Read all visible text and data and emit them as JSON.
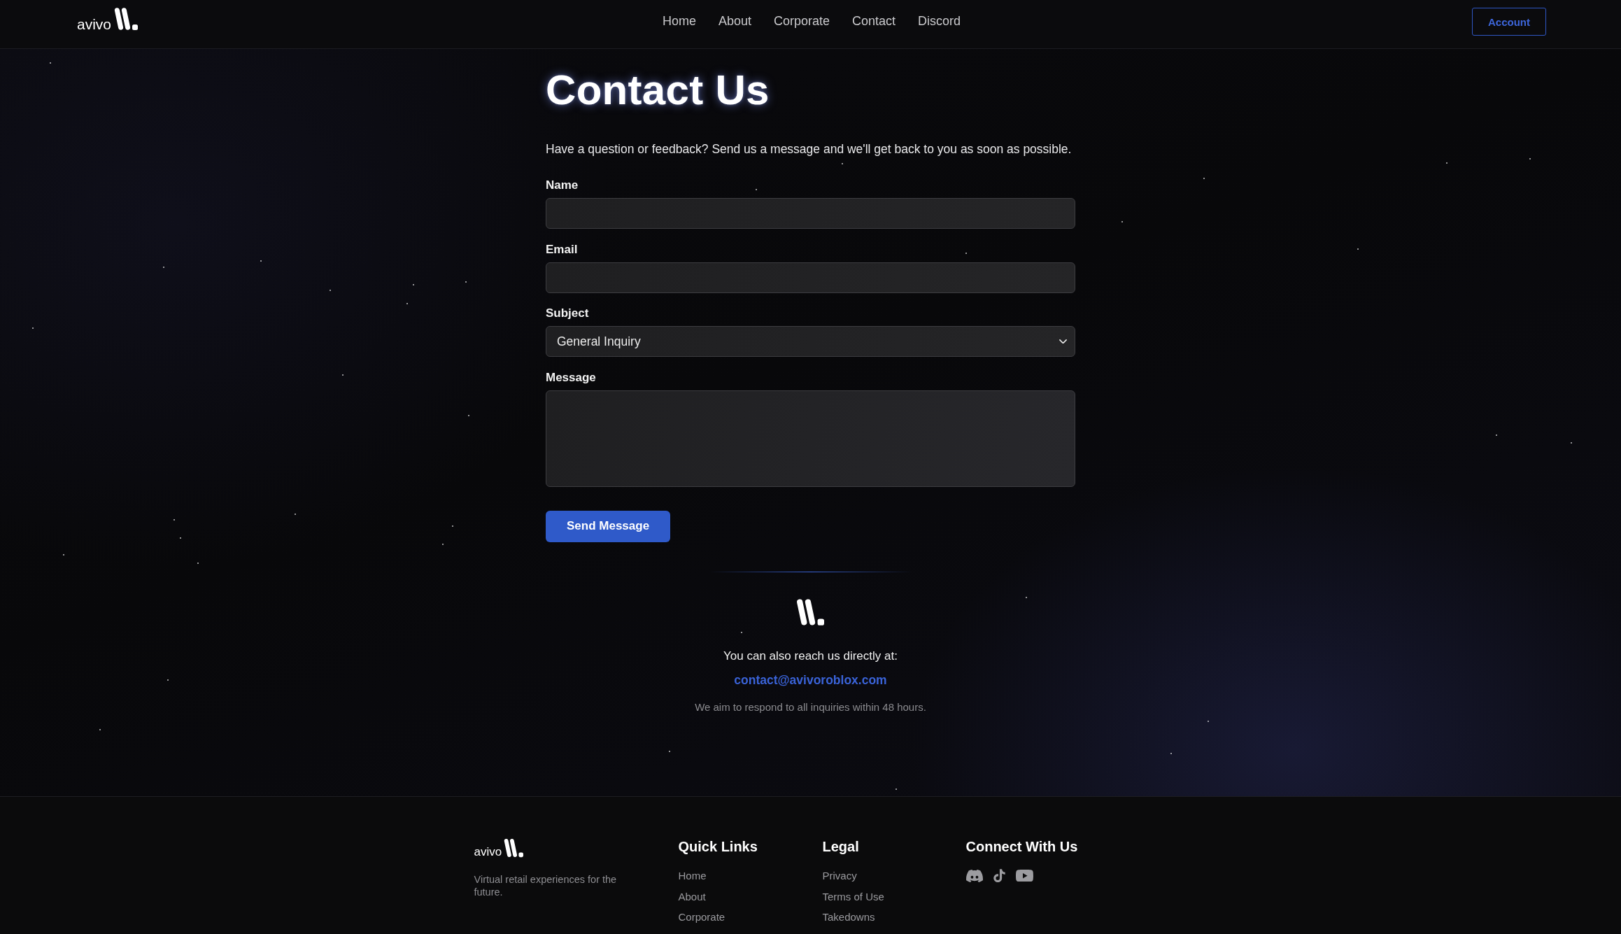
{
  "header": {
    "logo": {
      "wordmark": "avivo"
    },
    "nav": [
      {
        "label": "Home"
      },
      {
        "label": "About"
      },
      {
        "label": "Corporate"
      },
      {
        "label": "Contact"
      },
      {
        "label": "Discord"
      }
    ],
    "account_button": "Account"
  },
  "contact": {
    "title": "Contact Us",
    "intro": "Have a question or feedback? Send us a message and we'll get back to you as soon as possible.",
    "form": {
      "fields": [
        {
          "kind": "input",
          "label": "Name"
        },
        {
          "kind": "input",
          "label": "Email"
        },
        {
          "kind": "select",
          "label": "Subject",
          "value": "General Inquiry"
        },
        {
          "kind": "textarea",
          "label": "Message"
        }
      ],
      "submit_button": "Send Message"
    }
  },
  "direct_contact": {
    "lead": "You can also reach us directly at:",
    "email": "contact@avivoroblox.com",
    "note": "We aim to respond to all inquiries within 48 hours."
  },
  "footer": {
    "logo": {
      "wordmark": "avivo"
    },
    "tagline": "Virtual retail experiences for the future.",
    "link_columns": [
      {
        "heading": "Quick Links",
        "links": [
          "Home",
          "About",
          "Corporate"
        ]
      },
      {
        "heading": "Legal",
        "links": [
          "Privacy",
          "Terms of Use",
          "Takedowns"
        ]
      }
    ],
    "social": {
      "heading": "Connect With Us",
      "links": [
        {
          "kind": "discord"
        },
        {
          "kind": "tiktok"
        },
        {
          "kind": "youtube"
        }
      ]
    }
  }
}
